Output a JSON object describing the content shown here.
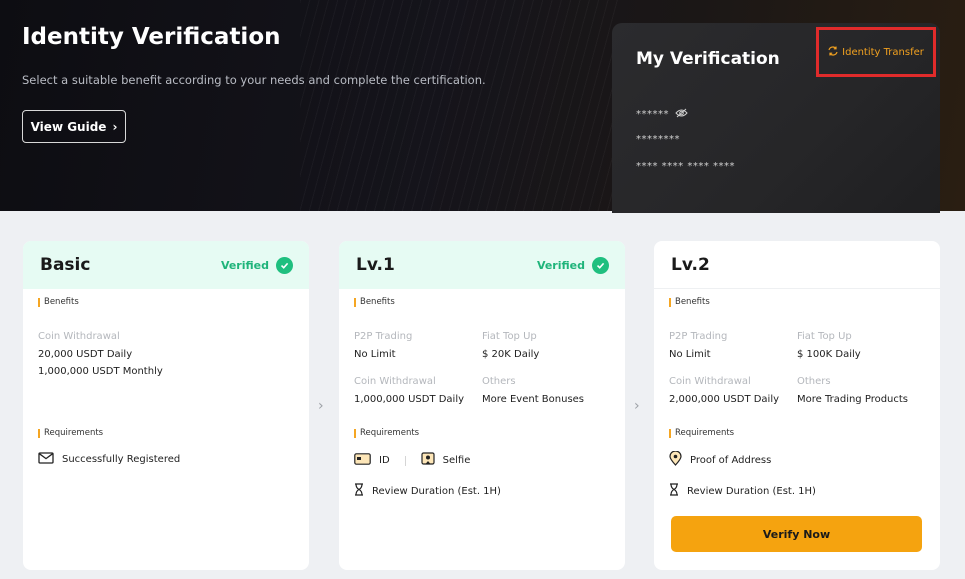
{
  "hero": {
    "title": "Identity Verification",
    "subtitle": "Select a suitable benefit according to your needs and complete the certification.",
    "guide_label": "View Guide",
    "guide_chevron": "›"
  },
  "my_verification": {
    "title": "My Verification",
    "transfer_label": "Identity Transfer",
    "masked_name": "******",
    "masked_id": "********",
    "masked_number": "**** **** **** ****"
  },
  "cards": [
    {
      "name": "Basic",
      "status": "Verified",
      "benefits_label": "Benefits",
      "benefits": [
        {
          "label": "Coin Withdrawal",
          "values": [
            "20,000 USDT Daily",
            "1,000,000 USDT Monthly"
          ]
        }
      ],
      "requirements_label": "Requirements",
      "requirements": [
        "Successfully Registered"
      ]
    },
    {
      "name": "Lv.1",
      "status": "Verified",
      "benefits_label": "Benefits",
      "benefits": [
        {
          "label": "P2P Trading",
          "values": [
            "No Limit"
          ]
        },
        {
          "label": "Fiat Top Up",
          "values": [
            "$ 20K Daily"
          ]
        },
        {
          "label": "Coin Withdrawal",
          "values": [
            "1,000,000 USDT Daily"
          ]
        },
        {
          "label": "Others",
          "values": [
            "More Event Bonuses"
          ]
        }
      ],
      "requirements_label": "Requirements",
      "requirements": [
        "ID",
        "Selfie"
      ],
      "review": "Review Duration (Est. 1H)"
    },
    {
      "name": "Lv.2",
      "benefits_label": "Benefits",
      "benefits": [
        {
          "label": "P2P Trading",
          "values": [
            "No Limit"
          ]
        },
        {
          "label": "Fiat Top Up",
          "values": [
            "$ 100K Daily"
          ]
        },
        {
          "label": "Coin Withdrawal",
          "values": [
            "2,000,000 USDT Daily"
          ]
        },
        {
          "label": "Others",
          "values": [
            "More Trading Products"
          ]
        }
      ],
      "requirements_label": "Requirements",
      "requirements": [
        "Proof of Address"
      ],
      "review": "Review Duration (Est. 1H)",
      "action_label": "Verify Now"
    }
  ],
  "colors": {
    "accent": "#f5a30f",
    "verified": "#1fb47a",
    "highlight_border": "#e02b2b"
  }
}
